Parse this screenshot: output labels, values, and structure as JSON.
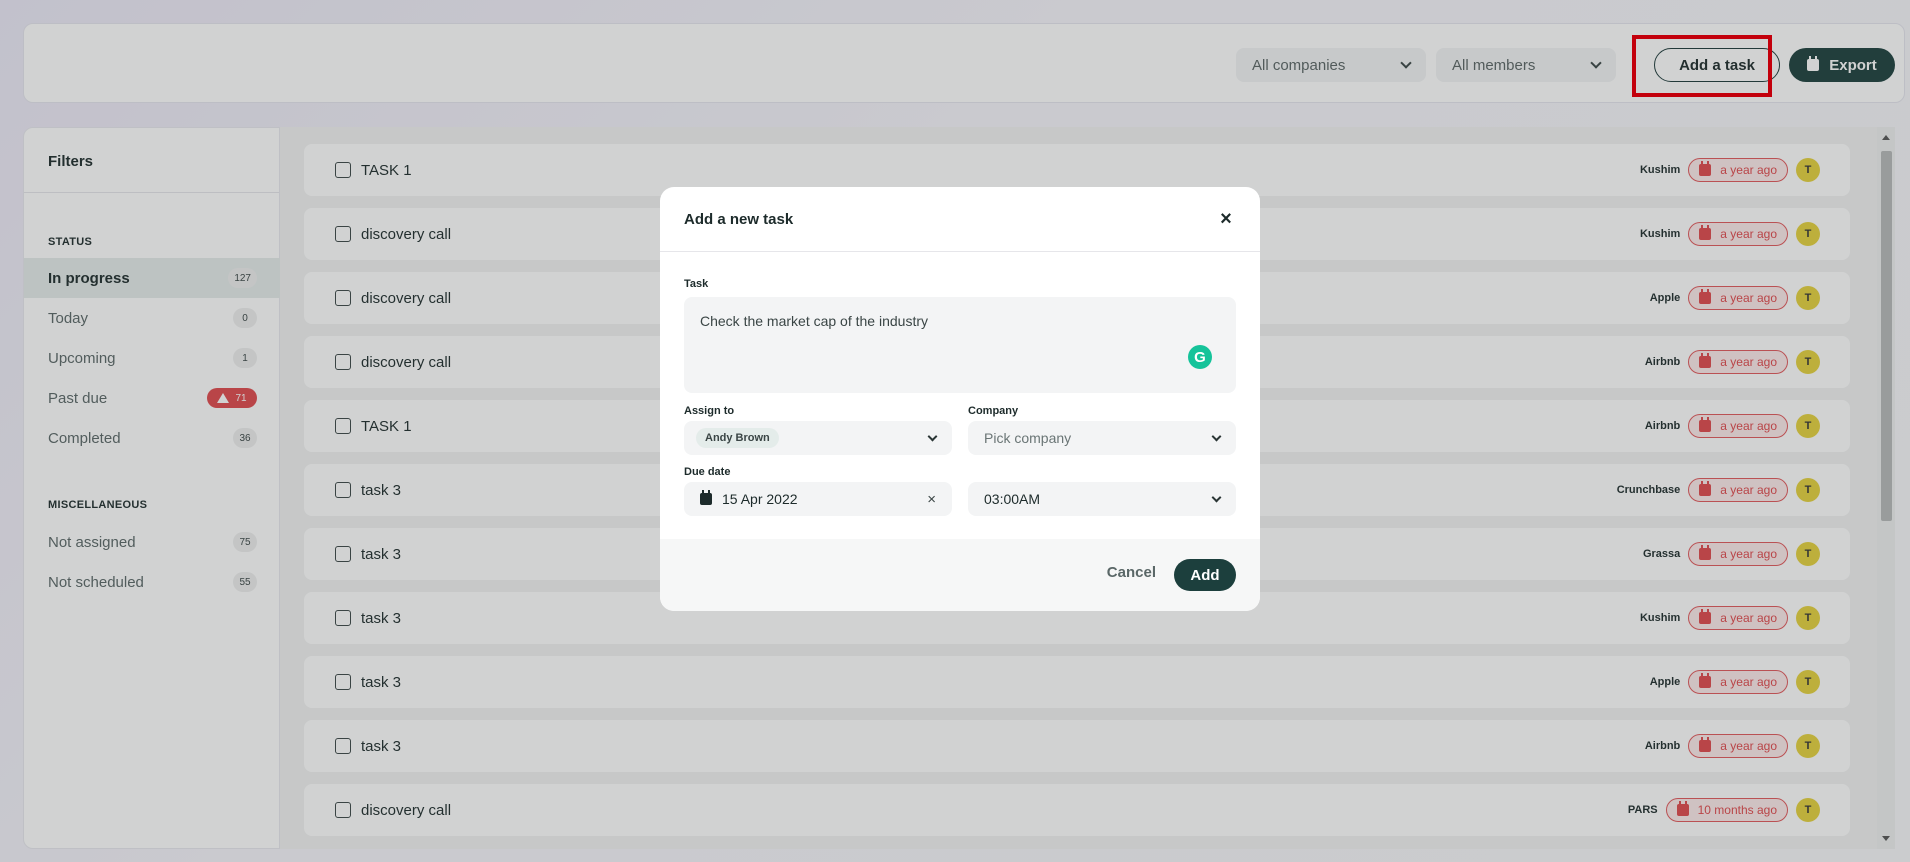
{
  "header": {
    "companies_select": "All companies",
    "members_select": "All members",
    "add_task_label": "Add a task",
    "export_label": "Export"
  },
  "sidebar": {
    "title": "Filters",
    "status_heading": "STATUS",
    "status_items": [
      {
        "label": "In progress",
        "count": "127"
      },
      {
        "label": "Today",
        "count": "0"
      },
      {
        "label": "Upcoming",
        "count": "1"
      },
      {
        "label": "Past due",
        "count": "71"
      },
      {
        "label": "Completed",
        "count": "36"
      }
    ],
    "misc_heading": "MISCELLANEOUS",
    "misc_items": [
      {
        "label": "Not assigned",
        "count": "75"
      },
      {
        "label": "Not scheduled",
        "count": "55"
      }
    ]
  },
  "tasks": [
    {
      "name": "TASK 1",
      "company": "Kushim",
      "time": "a year ago",
      "avatar": "T"
    },
    {
      "name": "discovery call",
      "company": "Kushim",
      "time": "a year ago",
      "avatar": "T"
    },
    {
      "name": "discovery call",
      "company": "Apple",
      "time": "a year ago",
      "avatar": "T"
    },
    {
      "name": "discovery call",
      "company": "Airbnb",
      "time": "a year ago",
      "avatar": "T"
    },
    {
      "name": "TASK 1",
      "company": "Airbnb",
      "time": "a year ago",
      "avatar": "T"
    },
    {
      "name": "task 3",
      "company": "Crunchbase",
      "time": "a year ago",
      "avatar": "T"
    },
    {
      "name": "task 3",
      "company": "Grassa",
      "time": "a year ago",
      "avatar": "T"
    },
    {
      "name": "task 3",
      "company": "Kushim",
      "time": "a year ago",
      "avatar": "T"
    },
    {
      "name": "task 3",
      "company": "Apple",
      "time": "a year ago",
      "avatar": "T"
    },
    {
      "name": "task 3",
      "company": "Airbnb",
      "time": "a year ago",
      "avatar": "T"
    },
    {
      "name": "discovery call",
      "company": "PARS",
      "time": "10 months ago",
      "avatar": "T"
    }
  ],
  "modal": {
    "title": "Add a new task",
    "close": "×",
    "task_label": "Task",
    "task_value": "Check the market cap of the industry",
    "grammarly": "G",
    "assign_label": "Assign to",
    "assign_value": "Andy Brown",
    "company_label": "Company",
    "company_placeholder": "Pick company",
    "due_label": "Due date",
    "due_value": "15 Apr 2022",
    "clear": "×",
    "time_value": "03:00AM",
    "cancel_label": "Cancel",
    "add_label": "Add"
  }
}
